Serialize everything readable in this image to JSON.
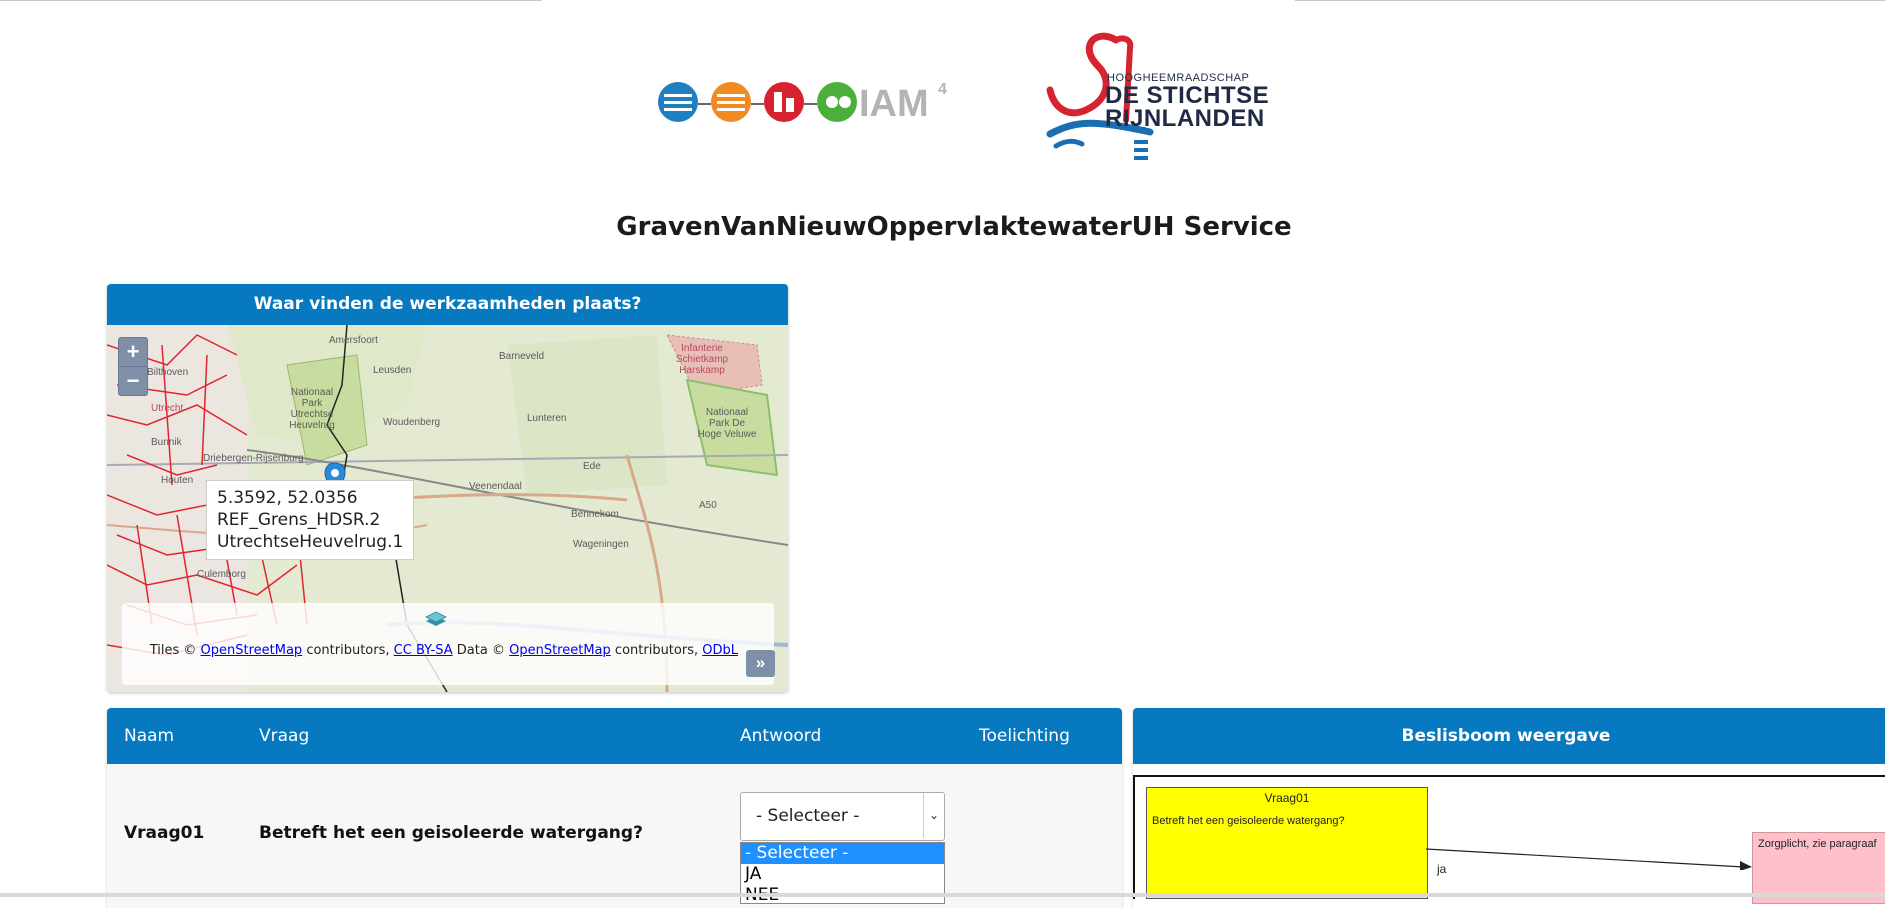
{
  "logos": {
    "iam_text": "IAM",
    "iam_superscript": "4",
    "hdsr_small": "HOOGHEEMRAADSCHAP",
    "hdsr_line1": "DE STICHTSE",
    "hdsr_line2": "RIJNLANDEN"
  },
  "page": {
    "title": "GravenVanNieuwOppervlaktewaterUH Service"
  },
  "map": {
    "header": "Waar vinden de werkzaamheden plaats?",
    "zoom_in": "+",
    "zoom_out": "−",
    "labels": [
      "Amersfoort",
      "Barneveld",
      "Leusden",
      "Bilthoven",
      "Utrecht",
      "Nationaal Park Utrechtse Heuvelrug",
      "Woudenberg",
      "Lunteren",
      "Infanterie Schietkamp Harskamp",
      "Nationaal Park De Hoge Veluwe",
      "Bunnik",
      "Driebergen-Rijsenburg",
      "Houten",
      "Ede",
      "Veenendaal",
      "Bennekom",
      "Wageningen",
      "Culemborg",
      "A50"
    ],
    "popup": {
      "coords": "5.3592, 52.0356",
      "line2": "REF_Grens_HDSR.2",
      "line3": "UtrechtseHeuvelrug.1"
    },
    "attribution": {
      "tiles_prefix": "Tiles ©",
      "osm1": "OpenStreetMap",
      "contrib1": "contributors,",
      "ccbysa": "CC BY-SA",
      "data_prefix": "Data ©",
      "osm2": "OpenStreetMap",
      "contrib2": "contributors,",
      "odbl": "ODbL"
    },
    "attrib_toggle": "»"
  },
  "questions": {
    "headers": {
      "naam": "Naam",
      "vraag": "Vraag",
      "antwoord": "Antwoord",
      "toelichting": "Toelichting"
    },
    "rows": [
      {
        "naam": "Vraag01",
        "vraag": "Betreft het een geisoleerde watergang?",
        "answer": "- Selecteer -"
      }
    ],
    "dropdown_options": [
      "- Selecteer -",
      "JA",
      "NEE"
    ]
  },
  "tree": {
    "header": "Beslisboom weergave",
    "node1_title": "Vraag01",
    "node1_text": "Betreft het een geisoleerde watergang?",
    "edge_label": "ja",
    "node2_text": "Zorgplicht, zie paragraaf"
  },
  "colors": {
    "primary": "#0679c1",
    "node_question": "#ffff00",
    "node_result": "#ffc0cb"
  }
}
